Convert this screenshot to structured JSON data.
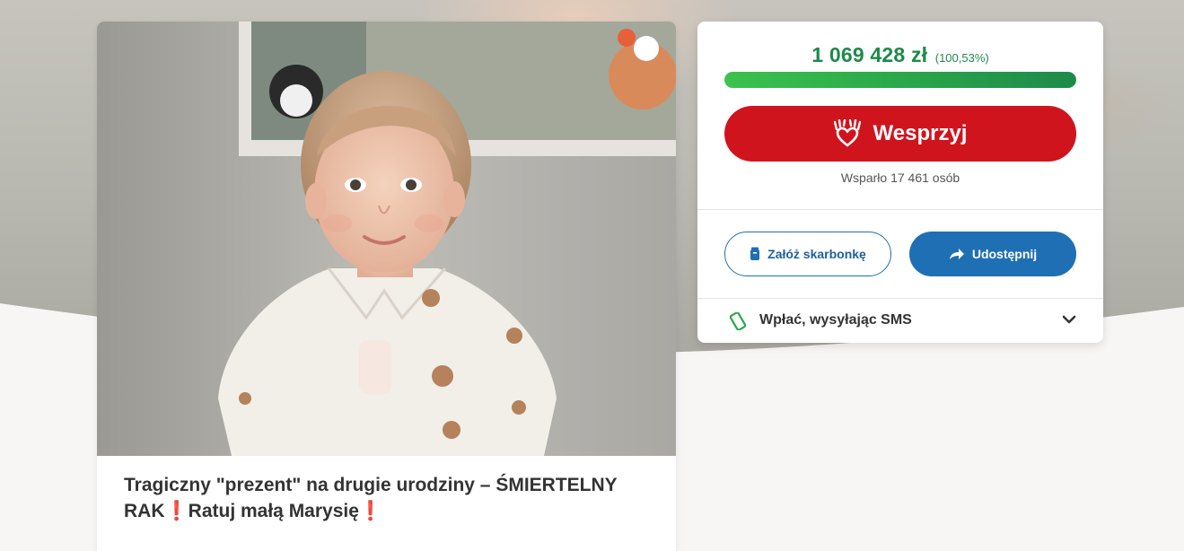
{
  "campaign": {
    "title_part1": "Tragiczny \"prezent\" na drugie urodziny – ŚMIERTELNY RAK",
    "title_part2": "Ratuj małą Marysię",
    "title_emoji": "❗",
    "photo_icon": "child-photo",
    "favorite_icon": "heart-outline-icon"
  },
  "donation": {
    "amount": "1 069 428 zł",
    "percent": "(100,53%)",
    "progress_fraction": 1.0,
    "support_button": "Wesprzyj",
    "support_icon": "hands-heart-icon",
    "supporters": "Wsparło 17 461 osób",
    "piggybank_button": "Załóż skarbonkę",
    "piggybank_icon": "piggy-jar-icon",
    "share_button": "Udostępnij",
    "share_icon": "share-arrow-icon",
    "sms_label": "Wpłać, wysyłając SMS",
    "sms_icon": "phone-icon",
    "expand_icon": "chevron-down-icon"
  },
  "colors": {
    "accent_green": "#1e8a4a",
    "support_red": "#d0141e",
    "action_blue": "#1f6fb5"
  }
}
